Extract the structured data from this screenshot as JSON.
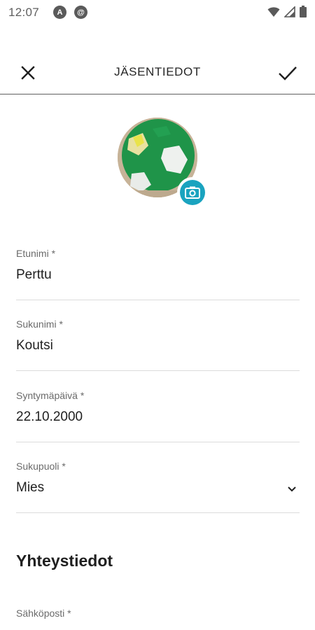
{
  "status_bar": {
    "time": "12:07",
    "app_icons": [
      "A",
      "@"
    ]
  },
  "appbar": {
    "title": "JÄSENTIEDOT",
    "close_icon": "close-icon",
    "save_icon": "check-icon"
  },
  "avatar": {
    "camera_icon": "camera-icon",
    "accent_color": "#1aa3bf"
  },
  "form": {
    "first_name": {
      "label": "Etunimi *",
      "value": "Perttu"
    },
    "last_name": {
      "label": "Sukunimi *",
      "value": "Koutsi"
    },
    "birthdate": {
      "label": "Syntymäpäivä *",
      "value": "22.10.2000"
    },
    "gender": {
      "label": "Sukupuoli *",
      "value": "Mies"
    }
  },
  "contact": {
    "section_title": "Yhteystiedot",
    "email": {
      "label": "Sähköposti *",
      "value": ""
    }
  }
}
